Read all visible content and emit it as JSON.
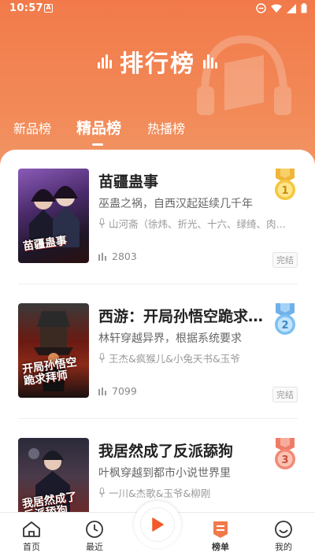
{
  "statusbar": {
    "time": "10:57",
    "app_indicator": "A"
  },
  "header": {
    "title": "排行榜"
  },
  "tabs": [
    {
      "label": "新品榜",
      "active": false
    },
    {
      "label": "精品榜",
      "active": true
    },
    {
      "label": "热播榜",
      "active": false
    }
  ],
  "books": [
    {
      "rank": "1",
      "name": "苗疆蛊事",
      "description": "巫蛊之祸，自西汉起延续几千年",
      "authors": "山河斋（徐炜、折光、十六、绿绮、肉包）",
      "plays": "2803",
      "status": "完结",
      "cover_text": "苗疆蛊事"
    },
    {
      "rank": "2",
      "name": "西游：开局孙悟空跪求拜师",
      "description": "林轩穿越异界，根据系统要求",
      "authors": "王杰&疯猴儿&小兔天书&玉爷",
      "plays": "7099",
      "status": "完结",
      "cover_text": "开局孙悟空跪求拜师"
    },
    {
      "rank": "3",
      "name": "我居然成了反派舔狗",
      "description": "叶枫穿越到都市小说世界里",
      "authors": "一川&杰歌&玉爷&柳刚",
      "plays": "",
      "status": "",
      "cover_text": "我居然成了反派舔狗"
    }
  ],
  "bottom_nav": [
    {
      "label": "首页",
      "icon": "home-icon"
    },
    {
      "label": "最近",
      "icon": "clock-icon"
    },
    {
      "label": "",
      "icon": "play-icon"
    },
    {
      "label": "榜单",
      "icon": "ranking-icon"
    },
    {
      "label": "我的",
      "icon": "profile-icon"
    }
  ],
  "colors": {
    "accent": "#f27a4a",
    "play": "#f25a2a"
  }
}
